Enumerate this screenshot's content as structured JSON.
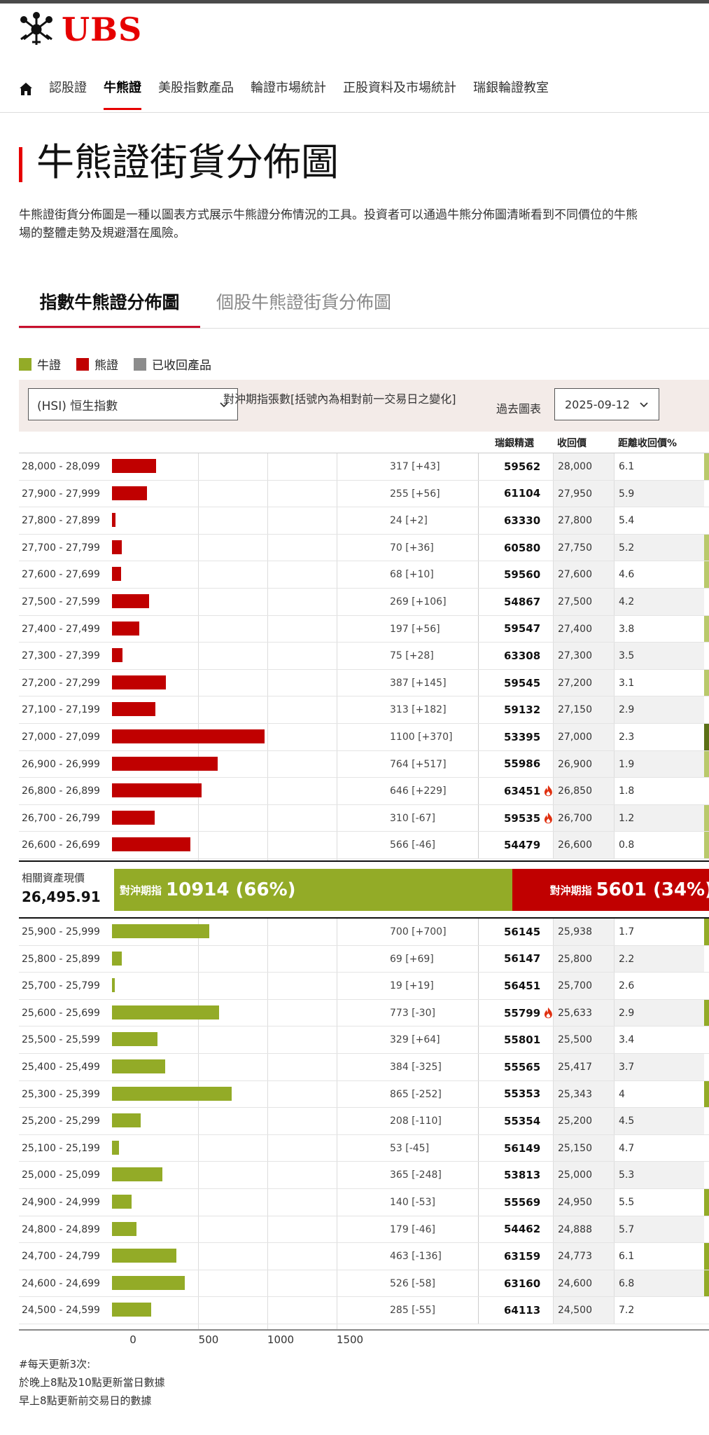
{
  "brand": {
    "name": "UBS",
    "logo": "ubs-keys-logo"
  },
  "nav": {
    "home_icon": "home-icon",
    "items": [
      "認股證",
      "牛熊證",
      "美股指數產品",
      "輪證市場統計",
      "正股資料及市場統計",
      "瑞銀輪證教室"
    ],
    "active": "牛熊證"
  },
  "page": {
    "title": "牛熊證街貨分佈圖",
    "intro": "牛熊證街貨分佈圖是一種以圖表方式展示牛熊證分佈情況的工具。投資者可以通過牛熊分佈圖清晰看到不同價位的牛熊\n場的整體走勢及規避潛在風險。"
  },
  "tabs": {
    "active": "指數牛熊證分佈圖",
    "inactive": "個股牛熊證街貨分佈圖"
  },
  "legend": [
    {
      "label": "牛證",
      "color": "#93ab27"
    },
    {
      "label": "熊證",
      "color": "#c00000"
    },
    {
      "label": "已收回產品",
      "color": "#8c8c8c"
    }
  ],
  "controls": {
    "index_select": "(HSI) 恒生指數",
    "hedge_label": "對沖期指張數[括號內為相對前一交易日之變化]",
    "past_chart_label": "過去圖表",
    "date_value": "2025-09-12"
  },
  "columns": {
    "code": "瑞銀精選",
    "call_price": "收回價",
    "distance": "距離收回價%"
  },
  "bear_rows": [
    {
      "range": "28,000 - 28,099",
      "count": 317,
      "label": "317 [+43]",
      "code": "59562",
      "call": "28,000",
      "dist": "6.1",
      "fire": false
    },
    {
      "range": "27,900 - 27,999",
      "count": 255,
      "label": "255 [+56]",
      "code": "61104",
      "call": "27,950",
      "dist": "5.9",
      "fire": false
    },
    {
      "range": "27,800 - 27,899",
      "count": 24,
      "label": "24 [+2]",
      "code": "63330",
      "call": "27,800",
      "dist": "5.4",
      "fire": false
    },
    {
      "range": "27,700 - 27,799",
      "count": 70,
      "label": "70 [+36]",
      "code": "60580",
      "call": "27,750",
      "dist": "5.2",
      "fire": false
    },
    {
      "range": "27,600 - 27,699",
      "count": 68,
      "label": "68 [+10]",
      "code": "59560",
      "call": "27,600",
      "dist": "4.6",
      "fire": false
    },
    {
      "range": "27,500 - 27,599",
      "count": 269,
      "label": "269 [+106]",
      "code": "54867",
      "call": "27,500",
      "dist": "4.2",
      "fire": false
    },
    {
      "range": "27,400 - 27,499",
      "count": 197,
      "label": "197 [+56]",
      "code": "59547",
      "call": "27,400",
      "dist": "3.8",
      "fire": false
    },
    {
      "range": "27,300 - 27,399",
      "count": 75,
      "label": "75 [+28]",
      "code": "63308",
      "call": "27,300",
      "dist": "3.5",
      "fire": false
    },
    {
      "range": "27,200 - 27,299",
      "count": 387,
      "label": "387 [+145]",
      "code": "59545",
      "call": "27,200",
      "dist": "3.1",
      "fire": false
    },
    {
      "range": "27,100 - 27,199",
      "count": 313,
      "label": "313 [+182]",
      "code": "59132",
      "call": "27,150",
      "dist": "2.9",
      "fire": false
    },
    {
      "range": "27,000 - 27,099",
      "count": 1100,
      "label": "1100 [+370]",
      "code": "53395",
      "call": "27,000",
      "dist": "2.3",
      "fire": false
    },
    {
      "range": "26,900 - 26,999",
      "count": 764,
      "label": "764 [+517]",
      "code": "55986",
      "call": "26,900",
      "dist": "1.9",
      "fire": false
    },
    {
      "range": "26,800 - 26,899",
      "count": 646,
      "label": "646 [+229]",
      "code": "63451",
      "call": "26,850",
      "dist": "1.8",
      "fire": true
    },
    {
      "range": "26,700 - 26,799",
      "count": 310,
      "label": "310 [-67]",
      "code": "59535",
      "call": "26,700",
      "dist": "1.2",
      "fire": true
    },
    {
      "range": "26,600 - 26,699",
      "count": 566,
      "label": "566 [-46]",
      "code": "54479",
      "call": "26,600",
      "dist": "0.8",
      "fire": false
    }
  ],
  "summary": {
    "spot_label": "相關資產現價",
    "spot_value": "26,495.91",
    "bull_prefix": "對沖期指",
    "bull_value": "10914 (66%)",
    "bull_share": 0.66,
    "bear_prefix": "對沖期指",
    "bear_value": "5601 (34%)"
  },
  "bull_rows": [
    {
      "range": "25,900 - 25,999",
      "count": 700,
      "label": "700 [+700]",
      "code": "56145",
      "call": "25,938",
      "dist": "1.7",
      "fire": false
    },
    {
      "range": "25,800 - 25,899",
      "count": 69,
      "label": "69 [+69]",
      "code": "56147",
      "call": "25,800",
      "dist": "2.2",
      "fire": false
    },
    {
      "range": "25,700 - 25,799",
      "count": 19,
      "label": "19 [+19]",
      "code": "56451",
      "call": "25,700",
      "dist": "2.6",
      "fire": false
    },
    {
      "range": "25,600 - 25,699",
      "count": 773,
      "label": "773 [-30]",
      "code": "55799",
      "call": "25,633",
      "dist": "2.9",
      "fire": true
    },
    {
      "range": "25,500 - 25,599",
      "count": 329,
      "label": "329 [+64]",
      "code": "55801",
      "call": "25,500",
      "dist": "3.4",
      "fire": false
    },
    {
      "range": "25,400 - 25,499",
      "count": 384,
      "label": "384 [-325]",
      "code": "55565",
      "call": "25,417",
      "dist": "3.7",
      "fire": false
    },
    {
      "range": "25,300 - 25,399",
      "count": 865,
      "label": "865 [-252]",
      "code": "55353",
      "call": "25,343",
      "dist": "4",
      "fire": false
    },
    {
      "range": "25,200 - 25,299",
      "count": 208,
      "label": "208 [-110]",
      "code": "55354",
      "call": "25,200",
      "dist": "4.5",
      "fire": false
    },
    {
      "range": "25,100 - 25,199",
      "count": 53,
      "label": "53 [-45]",
      "code": "56149",
      "call": "25,150",
      "dist": "4.7",
      "fire": false
    },
    {
      "range": "25,000 - 25,099",
      "count": 365,
      "label": "365 [-248]",
      "code": "53813",
      "call": "25,000",
      "dist": "5.3",
      "fire": false
    },
    {
      "range": "24,900 - 24,999",
      "count": 140,
      "label": "140 [-53]",
      "code": "55569",
      "call": "24,950",
      "dist": "5.5",
      "fire": false
    },
    {
      "range": "24,800 - 24,899",
      "count": 179,
      "label": "179 [-46]",
      "code": "54462",
      "call": "24,888",
      "dist": "5.7",
      "fire": false
    },
    {
      "range": "24,700 - 24,799",
      "count": 463,
      "label": "463 [-136]",
      "code": "63159",
      "call": "24,773",
      "dist": "6.1",
      "fire": false
    },
    {
      "range": "24,600 - 24,699",
      "count": 526,
      "label": "526 [-58]",
      "code": "63160",
      "call": "24,600",
      "dist": "6.8",
      "fire": false
    },
    {
      "range": "24,500 - 24,599",
      "count": 285,
      "label": "285 [-55]",
      "code": "64113",
      "call": "24,500",
      "dist": "7.2",
      "fire": false
    }
  ],
  "axis": {
    "ticks": [
      0,
      500,
      1000,
      1500
    ],
    "max": 2000
  },
  "footnote": [
    "#每天更新3次:",
    "於晚上8點及10點更新當日數據",
    "早上8點更新前交易日的數據"
  ]
}
